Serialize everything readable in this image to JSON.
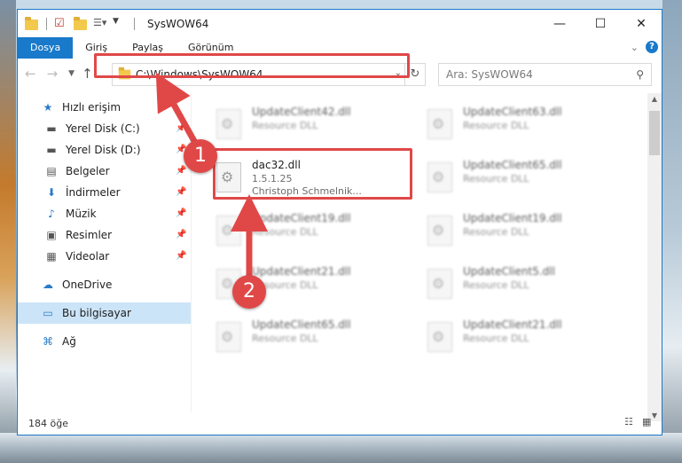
{
  "window": {
    "title": "SysWOW64",
    "controls": {
      "minimize": "—",
      "maximize": "☐",
      "close": "✕"
    }
  },
  "ribbon": {
    "tabs": [
      "Dosya",
      "Giriş",
      "Paylaş",
      "Görünüm"
    ],
    "active_tab": "Dosya",
    "expand_icon": "chevron-down",
    "help_label": "?"
  },
  "address": {
    "path": "C:\\Windows\\SysWOW64",
    "search_placeholder": "Ara: SysWOW64"
  },
  "navigation": {
    "items": [
      {
        "label": "Hızlı erişim",
        "icon": "star-icon",
        "glyph": "★"
      },
      {
        "label": "Yerel Disk (C:)",
        "icon": "drive-icon",
        "glyph": "▬"
      },
      {
        "label": "Yerel Disk (D:)",
        "icon": "drive-icon",
        "glyph": "▬"
      },
      {
        "label": "Belgeler",
        "icon": "documents-icon",
        "glyph": "▤"
      },
      {
        "label": "İndirmeler",
        "icon": "downloads-icon",
        "glyph": "⬇"
      },
      {
        "label": "Müzik",
        "icon": "music-icon",
        "glyph": "♪"
      },
      {
        "label": "Resimler",
        "icon": "pictures-icon",
        "glyph": "▣"
      },
      {
        "label": "Videolar",
        "icon": "videos-icon",
        "glyph": "▦"
      },
      {
        "label": "OneDrive",
        "icon": "cloud-icon",
        "glyph": "☁"
      },
      {
        "label": "Bu bilgisayar",
        "icon": "computer-icon",
        "glyph": "▭"
      },
      {
        "label": "Ağ",
        "icon": "network-icon",
        "glyph": "⌘"
      }
    ]
  },
  "files": [
    {
      "name": "UpdateClient42.dll",
      "type": "Resource DLL"
    },
    {
      "name": "UpdateClient63.dll",
      "type": "Resource DLL"
    },
    {
      "name": "dac32.dll",
      "version": "1.5.1.25",
      "company": "Christoph Schmelnik..."
    },
    {
      "name": "UpdateClient65.dll",
      "type": "Resource DLL"
    },
    {
      "name": "UpdateClient19.dll",
      "type": "Resource DLL"
    },
    {
      "name": "UpdateClient19.dll",
      "type": "Resource DLL"
    },
    {
      "name": "UpdateClient21.dll",
      "type": "Resource DLL"
    },
    {
      "name": "UpdateClient5.dll",
      "type": "Resource DLL"
    },
    {
      "name": "UpdateClient65.dll",
      "type": "Resource DLL"
    },
    {
      "name": "UpdateClient21.dll",
      "type": "Resource DLL"
    }
  ],
  "status": {
    "count": "184 öğe"
  },
  "annotations": {
    "step1": "1",
    "step2": "2",
    "color": "#e04848"
  }
}
